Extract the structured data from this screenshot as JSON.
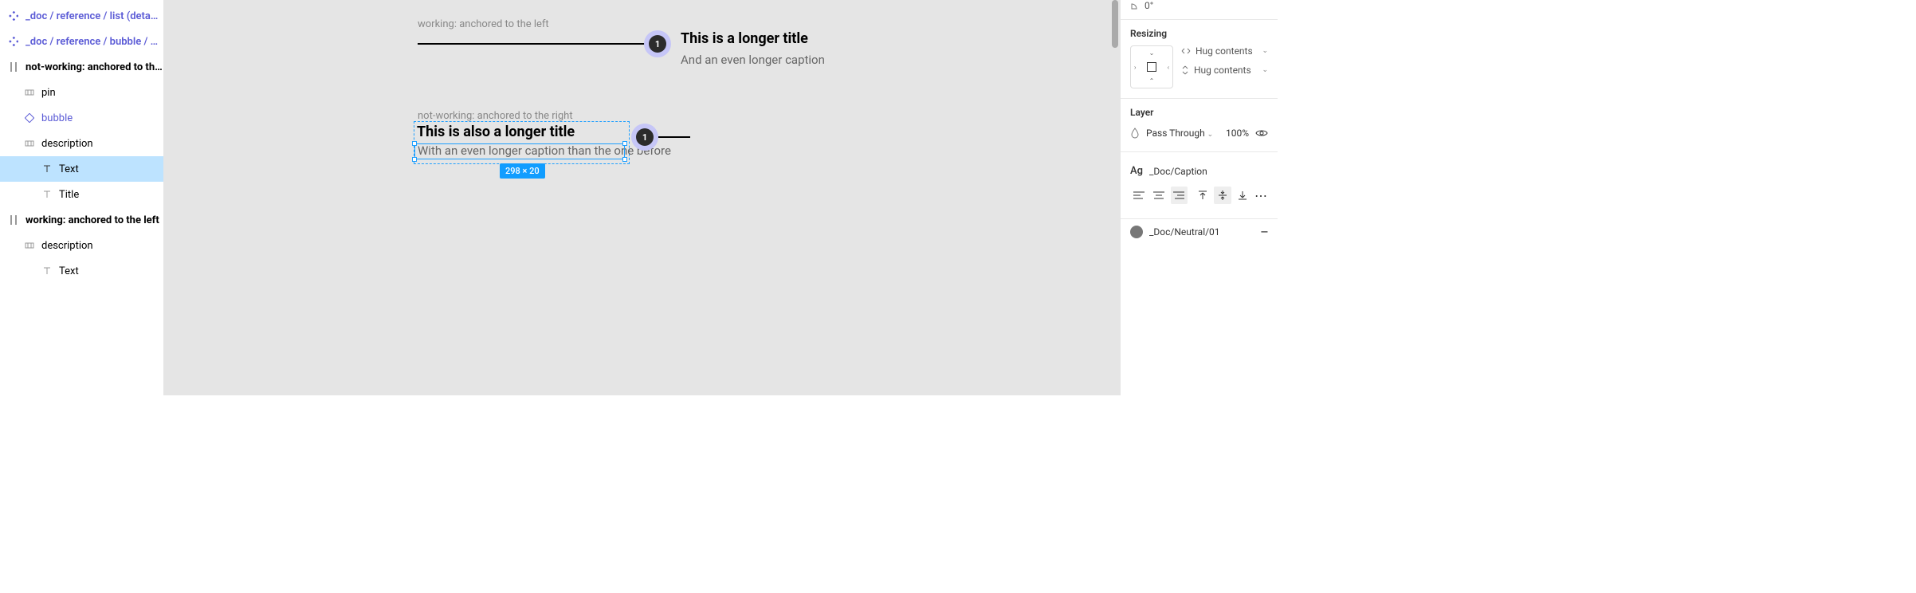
{
  "left_panel": {
    "items": [
      {
        "label": "_doc / reference / list  (detach to …"
      },
      {
        "label": "_doc / reference / bubble / base"
      },
      {
        "label": "not-working: anchored to the right"
      },
      {
        "label": "pin"
      },
      {
        "label": "bubble"
      },
      {
        "label": "description"
      },
      {
        "label": "Text"
      },
      {
        "label": "Title"
      },
      {
        "label": "working: anchored to the left"
      },
      {
        "label": "description"
      },
      {
        "label": "Text"
      }
    ]
  },
  "canvas": {
    "group1": {
      "caption": "working: anchored to the left",
      "bubble": "1",
      "title": "This is a longer title",
      "subtitle": "And an even longer caption"
    },
    "group2": {
      "caption": "not-working: anchored to the right",
      "bubble": "1",
      "title": "This is also a longer title",
      "subtitle": "With an even longer caption than the one before",
      "dims": "298 × 20"
    }
  },
  "right_panel": {
    "rotation": {
      "value": "0°"
    },
    "resizing": {
      "title": "Resizing",
      "horiz": "Hug contents",
      "vert": "Hug contents"
    },
    "layer": {
      "title": "Layer",
      "blend": "Pass Through",
      "opacity": "100%"
    },
    "text": {
      "style": "_Doc/Caption"
    },
    "fill": {
      "name": "_Doc/Neutral/01"
    }
  }
}
